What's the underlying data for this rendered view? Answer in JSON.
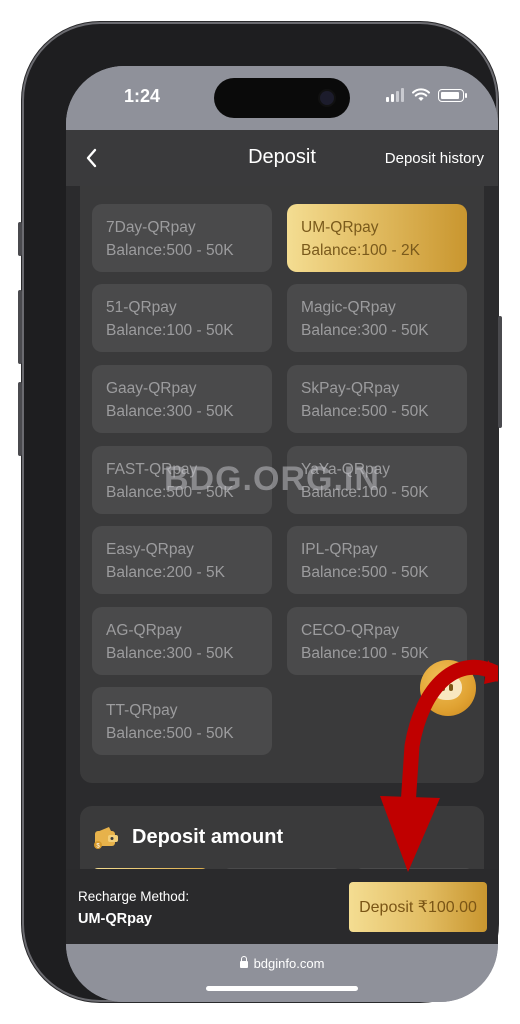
{
  "status": {
    "time": "1:24"
  },
  "header": {
    "title": "Deposit",
    "history_label": "Deposit history",
    "back_icon": "chevron-left-icon"
  },
  "methods": [
    {
      "name": "7Day-QRpay",
      "balance": "Balance:500 - 50K",
      "selected": false
    },
    {
      "name": "UM-QRpay",
      "balance": "Balance:100 - 2K",
      "selected": true
    },
    {
      "name": "51-QRpay",
      "balance": "Balance:100 - 50K",
      "selected": false
    },
    {
      "name": "Magic-QRpay",
      "balance": "Balance:300 - 50K",
      "selected": false
    },
    {
      "name": "Gaay-QRpay",
      "balance": "Balance:300 - 50K",
      "selected": false
    },
    {
      "name": "SkPay-QRpay",
      "balance": "Balance:500 - 50K",
      "selected": false
    },
    {
      "name": "FAST-QRpay",
      "balance": "Balance:500 - 50K",
      "selected": false
    },
    {
      "name": "YaYa-QRpay",
      "balance": "Balance:100 - 50K",
      "selected": false
    },
    {
      "name": "Easy-QRpay",
      "balance": "Balance:200 - 5K",
      "selected": false
    },
    {
      "name": "IPL-QRpay",
      "balance": "Balance:500 - 50K",
      "selected": false
    },
    {
      "name": "AG-QRpay",
      "balance": "Balance:300 - 50K",
      "selected": false
    },
    {
      "name": "CECO-QRpay",
      "balance": "Balance:100 - 50K",
      "selected": false
    },
    {
      "name": "TT-QRpay",
      "balance": "Balance:500 - 50K",
      "selected": false
    }
  ],
  "amount": {
    "title": "Deposit amount",
    "icon": "wallet-icon"
  },
  "bottom_bar": {
    "method_label": "Recharge Method:",
    "method_value": "UM-QRpay",
    "deposit_button": "Deposit ₹100.00"
  },
  "browser": {
    "url": "bdginfo.com"
  },
  "watermark": "BDG.ORG.IN",
  "colors": {
    "gold_start": "#f4dd92",
    "gold_end": "#c9962f",
    "card": "#4a4a4b",
    "panel": "#3a3a3b",
    "annotation_arrow": "#c00000"
  }
}
